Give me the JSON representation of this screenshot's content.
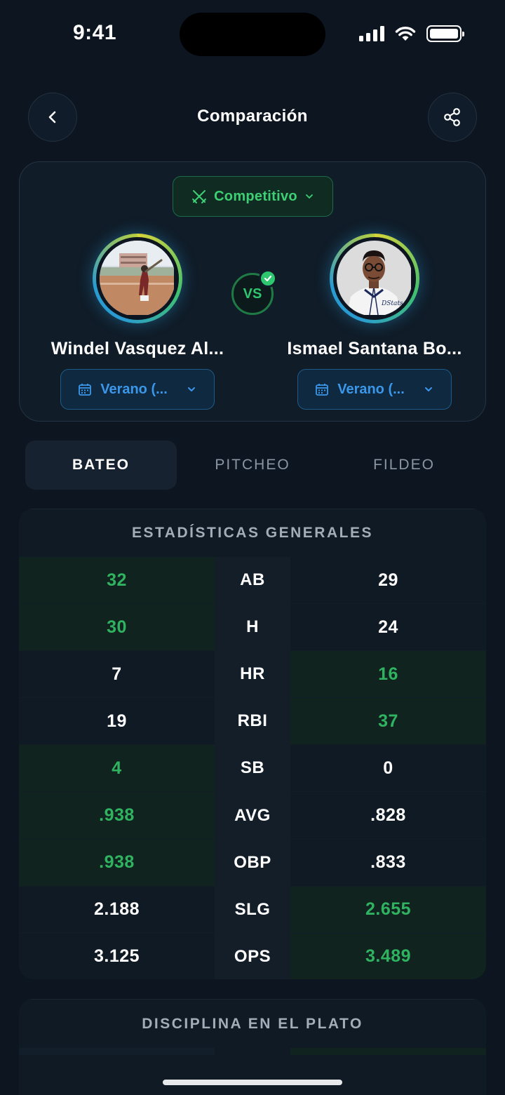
{
  "status_bar": {
    "time": "9:41"
  },
  "header": {
    "title": "Comparación"
  },
  "mode": {
    "label": "Competitivo"
  },
  "players": [
    {
      "name": "Windel Vasquez Al...",
      "season": "Verano (..."
    },
    {
      "name": "Ismael Santana Bo...",
      "season": "Verano (..."
    }
  ],
  "vs": {
    "label": "VS"
  },
  "tabs": [
    {
      "label": "BATEO",
      "active": true
    },
    {
      "label": "PITCHEO",
      "active": false
    },
    {
      "label": "FILDEO",
      "active": false
    }
  ],
  "general_stats": {
    "title": "ESTADÍSTICAS GENERALES",
    "rows": [
      {
        "stat": "AB",
        "left": "32",
        "right": "29",
        "winner": "left"
      },
      {
        "stat": "H",
        "left": "30",
        "right": "24",
        "winner": "left"
      },
      {
        "stat": "HR",
        "left": "7",
        "right": "16",
        "winner": "right"
      },
      {
        "stat": "RBI",
        "left": "19",
        "right": "37",
        "winner": "right"
      },
      {
        "stat": "SB",
        "left": "4",
        "right": "0",
        "winner": "left"
      },
      {
        "stat": "AVG",
        "left": ".938",
        "right": ".828",
        "winner": "left"
      },
      {
        "stat": "OBP",
        "left": ".938",
        "right": ".833",
        "winner": "left"
      },
      {
        "stat": "SLG",
        "left": "2.188",
        "right": "2.655",
        "winner": "right"
      },
      {
        "stat": "OPS",
        "left": "3.125",
        "right": "3.489",
        "winner": "right"
      }
    ]
  },
  "plate_discipline": {
    "title": "DISCIPLINA EN EL PLATO"
  },
  "colors": {
    "background": "#0c1520",
    "win_green": "#2fb360",
    "accent_blue": "#3b97ea",
    "mode_green": "#3ecf74"
  },
  "icons": {
    "back": "chevron-left-icon",
    "share": "share-icon",
    "mode": "crossed-swords-icon",
    "calendar": "calendar-icon",
    "dropdown": "chevron-down-icon",
    "check": "check-icon"
  }
}
